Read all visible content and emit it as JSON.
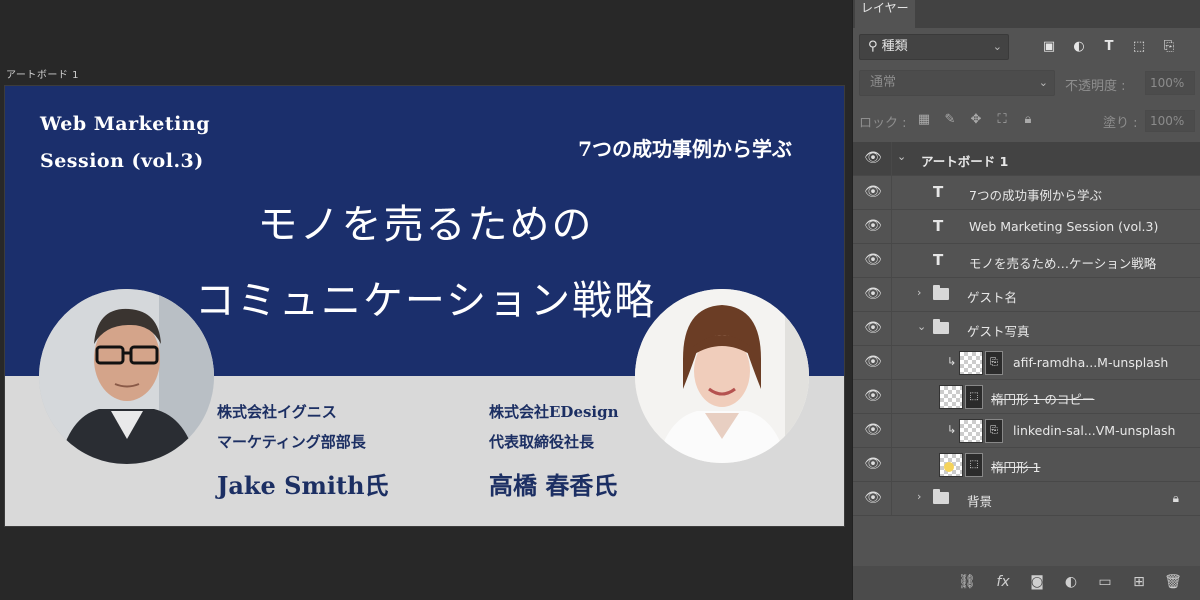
{
  "canvas": {
    "artboard_label": "アートボード 1",
    "design": {
      "session_title_line1": "Web Marketing",
      "session_title_line2": "Session (vol.3)",
      "subtitle": "7つの成功事例から学ぶ",
      "headline_line1": "モノを売るための",
      "headline_line2": "コミュニケーション戦略",
      "guests": [
        {
          "company": "株式会社イグニス",
          "role": "マーケティング部部長",
          "name": "Jake Smith氏"
        },
        {
          "company": "株式会社EDesign",
          "role": "代表取締役社長",
          "name": "高橋 春香氏"
        }
      ],
      "colors": {
        "navy": "#1b2f6c",
        "gray": "#d9d9d9",
        "name_text": "#1c2f63"
      }
    }
  },
  "panel": {
    "tab_label": "レイヤー",
    "filter": {
      "value": "種類",
      "icon": "search-icon"
    },
    "blend": {
      "value": "通常"
    },
    "opacity": {
      "label": "不透明度 :",
      "value": "100%"
    },
    "lock": {
      "label": "ロック :"
    },
    "fill": {
      "label": "塗り :",
      "value": "100%"
    },
    "layers": [
      {
        "name": "アートボード 1",
        "kind": "artboard"
      },
      {
        "name": "7つの成功事例から学ぶ",
        "kind": "text"
      },
      {
        "name": "Web Marketing Session (vol.3)",
        "kind": "text"
      },
      {
        "name": "モノを売るため…ケーション戦略",
        "kind": "text"
      },
      {
        "name": "ゲスト名",
        "kind": "group-collapsed"
      },
      {
        "name": "ゲスト写真",
        "kind": "group-expanded"
      },
      {
        "name": "afif-ramdha...M-unsplash",
        "kind": "clipped-image"
      },
      {
        "name": "楕円形 1 のコピー",
        "kind": "shape"
      },
      {
        "name": "linkedin-sal...VM-unsplash",
        "kind": "clipped-image"
      },
      {
        "name": "楕円形 1",
        "kind": "shape"
      },
      {
        "name": "背景",
        "kind": "group-locked"
      }
    ]
  }
}
